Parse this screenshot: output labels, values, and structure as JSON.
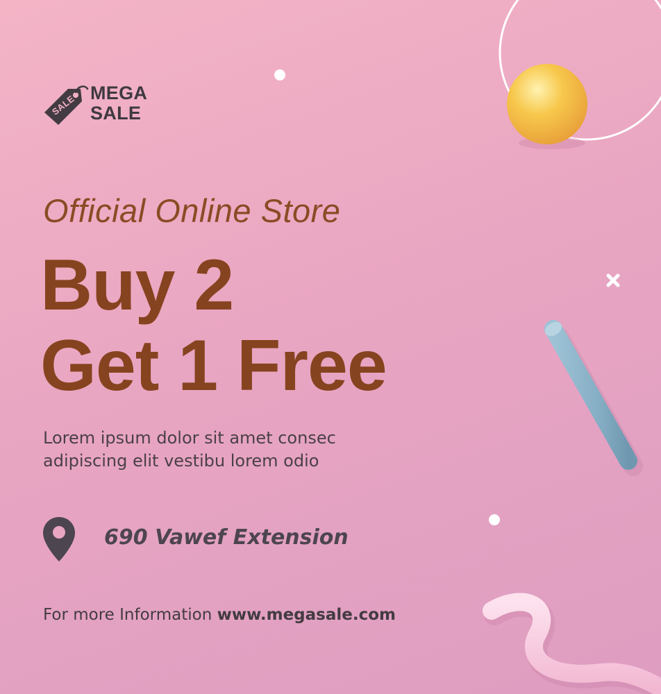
{
  "logo": {
    "tag_text": "SALE",
    "line1": "MEGA",
    "line2": "SALE"
  },
  "tagline": "Official Online Store",
  "headline": {
    "line1": "Buy 2",
    "line2": "Get 1 Free"
  },
  "body": {
    "line1": "Lorem ipsum dolor sit amet consec",
    "line2": "adipiscing elit vestibu lorem odio"
  },
  "location": {
    "icon": "map-pin-icon",
    "address": "690 Vawef Extension"
  },
  "footer": {
    "prefix": "For more Information",
    "url": "www.megasale.com"
  },
  "colors": {
    "background_top": "#f4b4c6",
    "background_bottom": "#de9dc1",
    "headline": "#86431f",
    "dark_text": "#433b42",
    "ball": "#f5c24a",
    "rod": "#8fb3c8",
    "squiggle": "#f6c6dc"
  }
}
